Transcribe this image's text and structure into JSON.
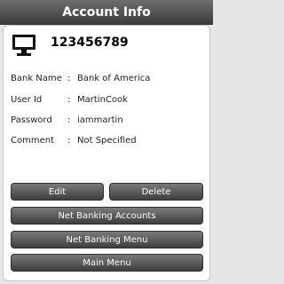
{
  "title": "Account Info",
  "account": {
    "number": "123456789",
    "icon": "computer-icon"
  },
  "fields": [
    {
      "label": "Bank Name",
      "separator": ":",
      "value": "Bank of America"
    },
    {
      "label": "User Id",
      "separator": ":",
      "value": "MartinCook"
    },
    {
      "label": "Password",
      "separator": ":",
      "value": "iammartin"
    },
    {
      "label": "Comment",
      "separator": ":",
      "value": "Not Specified"
    }
  ],
  "buttons": {
    "edit": "Edit",
    "delete": "Delete",
    "net_banking_accounts": "Net Banking Accounts",
    "net_banking_menu": "Net Banking Menu",
    "main_menu": "Main Menu"
  },
  "colors": {
    "title_bar": "#3a3a3a",
    "button": "#555555",
    "background": "#e6e6e6"
  }
}
